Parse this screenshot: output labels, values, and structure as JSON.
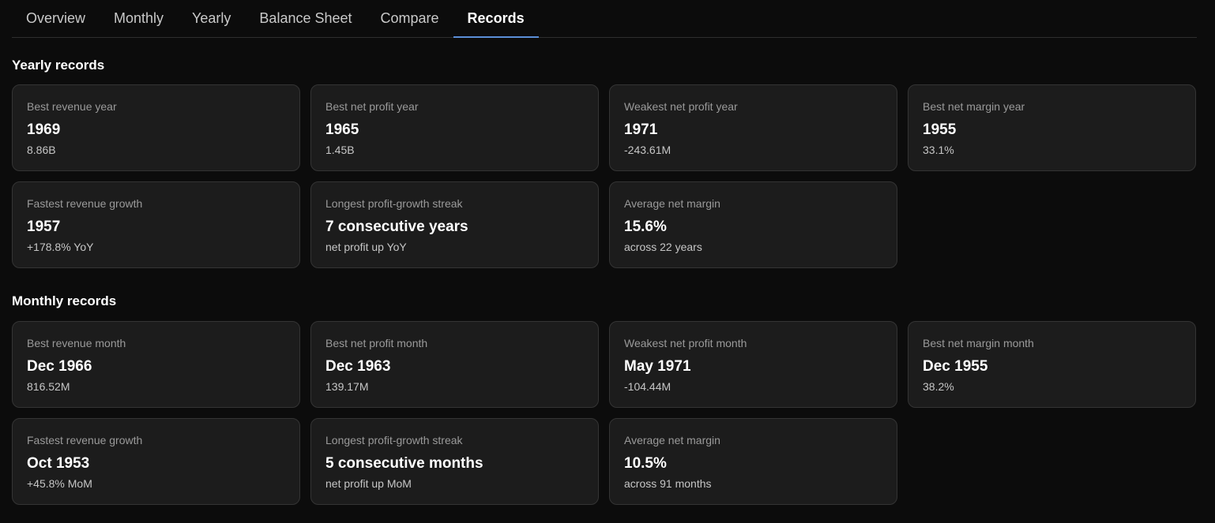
{
  "tabs": [
    {
      "label": "Overview",
      "active": false
    },
    {
      "label": "Monthly",
      "active": false
    },
    {
      "label": "Yearly",
      "active": false
    },
    {
      "label": "Balance Sheet",
      "active": false
    },
    {
      "label": "Compare",
      "active": false
    },
    {
      "label": "Records",
      "active": true
    }
  ],
  "colors": {
    "background": "#0c0c0c",
    "card": "#1c1c1c",
    "card_border": "#343434",
    "accent": "#5b8fd8"
  },
  "yearly": {
    "title": "Yearly records",
    "cards": [
      {
        "label": "Best revenue year",
        "value": "1969",
        "sub": "8.86B"
      },
      {
        "label": "Best net profit year",
        "value": "1965",
        "sub": "1.45B"
      },
      {
        "label": "Weakest net profit year",
        "value": "1971",
        "sub": "-243.61M"
      },
      {
        "label": "Best net margin year",
        "value": "1955",
        "sub": "33.1%"
      },
      {
        "label": "Fastest revenue growth",
        "value": "1957",
        "sub": "+178.8% YoY"
      },
      {
        "label": "Longest profit-growth streak",
        "value": "7 consecutive years",
        "sub": "net profit up YoY"
      },
      {
        "label": "Average net margin",
        "value": "15.6%",
        "sub": "across 22 years"
      }
    ]
  },
  "monthly": {
    "title": "Monthly records",
    "cards": [
      {
        "label": "Best revenue month",
        "value": "Dec 1966",
        "sub": "816.52M"
      },
      {
        "label": "Best net profit month",
        "value": "Dec 1963",
        "sub": "139.17M"
      },
      {
        "label": "Weakest net profit month",
        "value": "May 1971",
        "sub": "-104.44M"
      },
      {
        "label": "Best net margin month",
        "value": "Dec 1955",
        "sub": "38.2%"
      },
      {
        "label": "Fastest revenue growth",
        "value": "Oct 1953",
        "sub": "+45.8% MoM"
      },
      {
        "label": "Longest profit-growth streak",
        "value": "5 consecutive months",
        "sub": "net profit up MoM"
      },
      {
        "label": "Average net margin",
        "value": "10.5%",
        "sub": "across 91 months"
      }
    ]
  }
}
